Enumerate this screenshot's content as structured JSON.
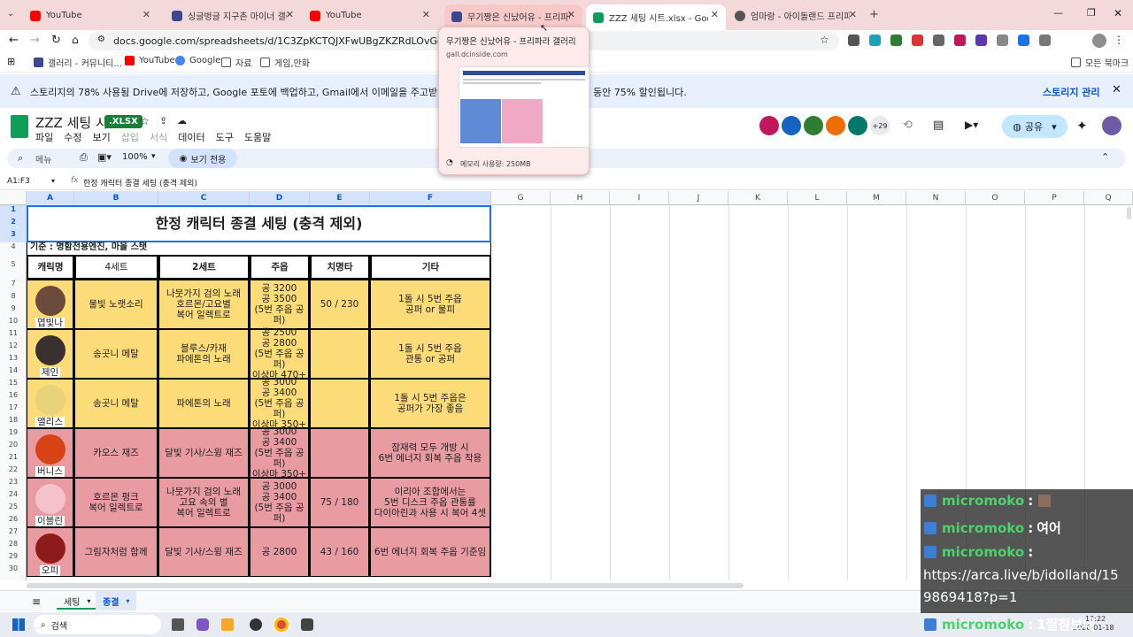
{
  "browser": {
    "tabs": [
      {
        "title": "YouTube",
        "color": "#ff0000"
      },
      {
        "title": "싱글벙글 지구촌 마이너 갤러리",
        "color": "#3b4890"
      },
      {
        "title": "YouTube",
        "color": "#ff0000"
      },
      {
        "title": "무기짱은 신났어유 - 프리파라",
        "color": "#3b4890"
      },
      {
        "title": "ZZZ 세팅 시트.xlsx - Google S",
        "color": "#0f9d58"
      },
      {
        "title": "엄마랑 - 아이돌랜드 프리파리",
        "color": "#555555"
      }
    ],
    "url": "docs.google.com/spreadsheets/d/1C3ZpKCTQJXFwUBgZKZRdLOvGqDGlVjib/edit?gid=1",
    "bookmarks": [
      "갤러리 - 커뮤니티...",
      "YouTube",
      "Google",
      "자료",
      "게임,만화"
    ],
    "bookmarks_right": "모든 북마크",
    "popup": {
      "title": "무기짱은 신났어유 - 프리파라 갤러리",
      "domain": "gall.dcinside.com",
      "memory": "메모리 사용량: 250MB"
    }
  },
  "banner": {
    "text": "스토리지의 78% 사용됨  Drive에 저장하고, Google 포토에 백업하고, Gmail에서 이메일을 주고받을 때 스토리지를 사용",
    "text_tail": "동안 75% 할인됩니다.",
    "action": "스토리지 관리"
  },
  "doc": {
    "title": "ZZZ 세팅 시트",
    "badge": ".XLSX",
    "menus": [
      "파일",
      "수정",
      "보기",
      "삽입",
      "서식",
      "데이터",
      "도구",
      "도움말"
    ],
    "search": "메뉴",
    "zoom": "100%",
    "view_mode": "보기 전용",
    "share": "공유",
    "collab_count": "+29",
    "cell_ref": "A1:F3",
    "formula": "한정 캐릭터 종결 세팅 (충격 제외)"
  },
  "columns": [
    "A",
    "B",
    "C",
    "D",
    "E",
    "F",
    "G",
    "H",
    "I",
    "J",
    "K",
    "L",
    "M",
    "N",
    "O",
    "P",
    "Q"
  ],
  "sheet": {
    "title": "한정 캐릭터 종결 세팅 (충격 제외)",
    "basis": "기준 : 명함전용엔진, 마을 스탯",
    "headers": [
      "캐릭명",
      "4세트",
      "2세트",
      "주옵",
      "치명타",
      "기타"
    ],
    "rows": [
      {
        "name": "엽빛나",
        "set4": "물빛 노랫소리",
        "set2": "나뭇가지 검의 노래\n호르몬/고요별\n복어 일렉트로",
        "main": "공 3200\n공 3500\n(5번 주옵 공퍼)",
        "crit": "50 / 230",
        "etc": "1돌 시 5번 주옵\n공퍼 or 물피",
        "color": "y"
      },
      {
        "name": "제인",
        "set4": "송곳니 메탈",
        "set2": "블루스/카재\n파에톤의 노래",
        "main": "공 2500\n공 2800\n(5번 주옵 공퍼)\n이상마 470+",
        "crit": "",
        "etc": "1돌 시 5번 주옵\n관통 or 공퍼",
        "color": "y"
      },
      {
        "name": "앨리스",
        "set4": "송곳니 메탈",
        "set2": "파에톤의 노래",
        "main": "공 3000\n공 3400\n(5번 주옵 공퍼)\n이상마 350+",
        "crit": "",
        "etc": "1돌 시 5번 주옵은\n공퍼가 가장 좋음",
        "color": "y"
      },
      {
        "name": "버니스",
        "set4": "카오스 재즈",
        "set2": "달빛 기사/스윙 재즈",
        "main": "공 3000\n공 3400\n(5번 주옵 공퍼)\n이상마 350+",
        "crit": "",
        "etc": "잠재력 모두 개방 시\n6번 에너지 회복 주옵 착용",
        "color": "p"
      },
      {
        "name": "이블린",
        "set4": "호르몬 펑크\n복어 일렉트로",
        "set2": "나뭇가지 검의 노래\n고요 속의 별\n복어 일렉트로",
        "main": "공 3000\n공 3400\n(5번 주옵 공퍼)",
        "crit": "75 / 180",
        "etc": "이리아 조합에서는\n5번 디스크 주옵 관통률\n다이아린과 사용 시 복어 4셋",
        "color": "p"
      },
      {
        "name": "오피",
        "set4": "그림자처럼 함께",
        "set2": "달빛 기사/스윙 재즈",
        "main": "공 2800",
        "crit": "43 / 160",
        "etc": "6번 에너지 회복 주옵 기준임",
        "color": "p"
      }
    ]
  },
  "sheet_tabs": [
    "세팅",
    "종결"
  ],
  "chat": [
    {
      "user": "micromoko",
      "text": ""
    },
    {
      "user": "micromoko",
      "text": "여어"
    },
    {
      "user": "micromoko",
      "text": ""
    },
    {
      "user": "",
      "text": "https://arca.live/b/idolland/15"
    },
    {
      "user": "",
      "text": "9869418?p=1"
    },
    {
      "user": "micromoko",
      "text": "1짤첨보네"
    }
  ],
  "taskbar": {
    "search": "검색",
    "time": "12:22",
    "date": "2026-01-18"
  }
}
